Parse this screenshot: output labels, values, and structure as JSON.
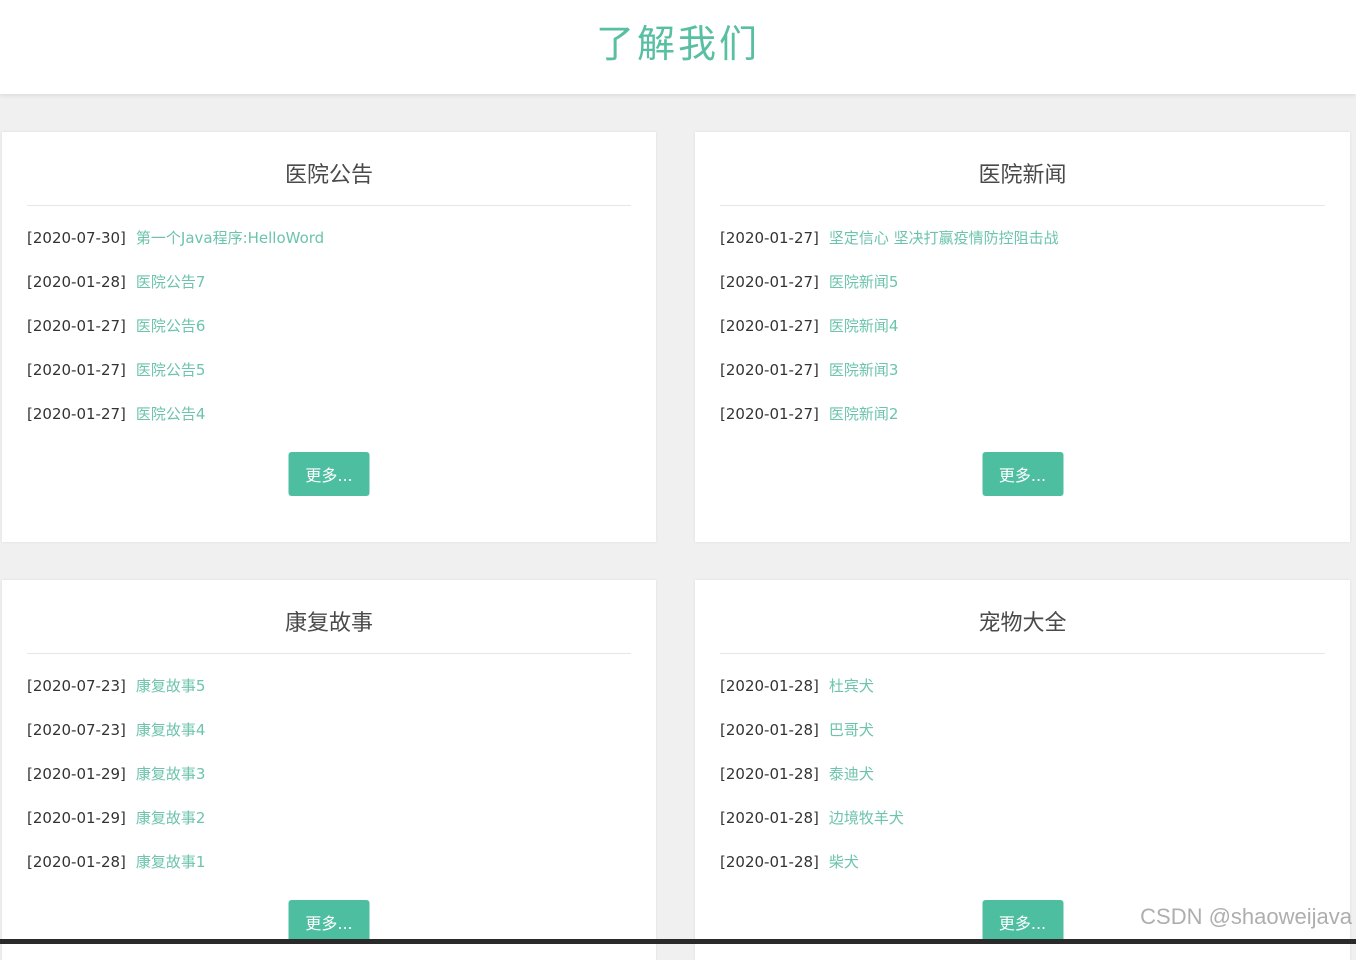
{
  "header": {
    "title": "了解我们"
  },
  "cards": [
    {
      "title": "医院公告",
      "items": [
        {
          "date": "[2020-07-30]",
          "title": "第一个Java程序:HelloWord"
        },
        {
          "date": "[2020-01-28]",
          "title": "医院公告7"
        },
        {
          "date": "[2020-01-27]",
          "title": "医院公告6"
        },
        {
          "date": "[2020-01-27]",
          "title": "医院公告5"
        },
        {
          "date": "[2020-01-27]",
          "title": "医院公告4"
        }
      ],
      "more_label": "更多..."
    },
    {
      "title": "医院新闻",
      "items": [
        {
          "date": "[2020-01-27]",
          "title": "坚定信心 坚决打赢疫情防控阻击战"
        },
        {
          "date": "[2020-01-27]",
          "title": "医院新闻5"
        },
        {
          "date": "[2020-01-27]",
          "title": "医院新闻4"
        },
        {
          "date": "[2020-01-27]",
          "title": "医院新闻3"
        },
        {
          "date": "[2020-01-27]",
          "title": "医院新闻2"
        }
      ],
      "more_label": "更多..."
    },
    {
      "title": "康复故事",
      "items": [
        {
          "date": "[2020-07-23]",
          "title": "康复故事5"
        },
        {
          "date": "[2020-07-23]",
          "title": "康复故事4"
        },
        {
          "date": "[2020-01-29]",
          "title": "康复故事3"
        },
        {
          "date": "[2020-01-29]",
          "title": "康复故事2"
        },
        {
          "date": "[2020-01-28]",
          "title": "康复故事1"
        }
      ],
      "more_label": "更多..."
    },
    {
      "title": "宠物大全",
      "items": [
        {
          "date": "[2020-01-28]",
          "title": "杜宾犬"
        },
        {
          "date": "[2020-01-28]",
          "title": "巴哥犬"
        },
        {
          "date": "[2020-01-28]",
          "title": "泰迪犬"
        },
        {
          "date": "[2020-01-28]",
          "title": "边境牧羊犬"
        },
        {
          "date": "[2020-01-28]",
          "title": "柴犬"
        }
      ],
      "more_label": "更多..."
    }
  ],
  "watermark": "CSDN @shaoweijava",
  "colors": {
    "accent": "#58bfa3",
    "button": "#4dbfa0",
    "link": "#6cc4ad",
    "background": "#f0f0f0"
  }
}
